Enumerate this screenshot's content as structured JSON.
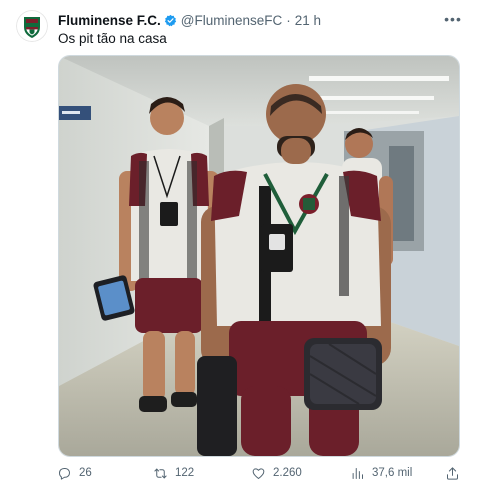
{
  "tweet": {
    "author_name": "Fluminense F.C.",
    "author_handle": "@FluminenseFC",
    "separator": "·",
    "time": "21 h",
    "text": "Os pit tão na casa",
    "more_label": "•••"
  },
  "media": {
    "sign_text": "",
    "badge_text": "",
    "description_colors": {
      "shirt": "#e9e8e3",
      "shorts": "#6b1f2a",
      "accent_green": "#1f5e3a",
      "corridor_wall": "#dcdfdc",
      "floor": "#bdbcae"
    }
  },
  "actions": {
    "replies": "26",
    "retweets": "122",
    "likes": "2.260",
    "views": "37,6 mil"
  },
  "icons": [
    "club-crest-icon",
    "verified-badge-icon",
    "more-icon",
    "reply-icon",
    "retweet-icon",
    "like-icon",
    "views-icon",
    "share-icon"
  ],
  "colors": {
    "text_primary": "#0f1419",
    "text_secondary": "#536471",
    "verified_blue": "#1d9bf0",
    "border": "#cfd9de",
    "club_garnet": "#7a1f2b",
    "club_green": "#0f6a3c"
  }
}
